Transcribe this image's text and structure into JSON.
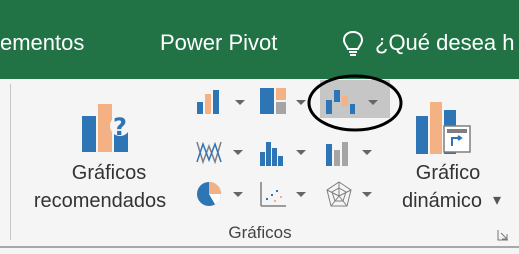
{
  "tabs": {
    "complementos_partial": "ementos",
    "power_pivot": "Power Pivot",
    "tell_me": "¿Qué desea h"
  },
  "charts_group": {
    "recommended_line1": "Gráficos",
    "recommended_line2": "recomendados",
    "pivot_line1": "Gráfico",
    "pivot_line2": "dinámico",
    "pivot_arrow": "▾",
    "group_label": "Gráficos"
  },
  "colors": {
    "ribbon_tab_green": "#217346",
    "ribbon_bg": "#f5f5f5",
    "highlight": "#c6c6c6",
    "chart_blue": "#2e75b6",
    "chart_orange": "#f4b183"
  }
}
